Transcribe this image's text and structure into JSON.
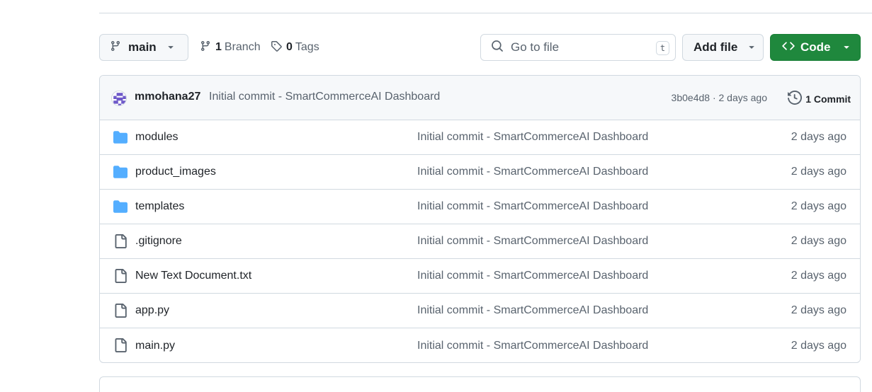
{
  "toolbar": {
    "branch": "main",
    "branches_count": "1",
    "branches_label": "Branch",
    "tags_count": "0",
    "tags_label": "Tags",
    "search_placeholder": "Go to file",
    "search_shortcut": "t",
    "add_file_label": "Add file",
    "code_label": "Code",
    "code_color": "#1f883d"
  },
  "commit": {
    "author": "mmohana27",
    "message": "Initial commit - SmartCommerceAI Dashboard",
    "hash_age": "3b0e4d8 · 2 days ago",
    "count_label": "1 Commit"
  },
  "files": [
    {
      "name": "modules",
      "type": "folder-icon",
      "message": "Initial commit - SmartCommerceAI Dashboard",
      "age": "2 days ago"
    },
    {
      "name": "product_images",
      "type": "folder-icon",
      "message": "Initial commit - SmartCommerceAI Dashboard",
      "age": "2 days ago"
    },
    {
      "name": "templates",
      "type": "folder-icon",
      "message": "Initial commit - SmartCommerceAI Dashboard",
      "age": "2 days ago"
    },
    {
      "name": ".gitignore",
      "type": "file-icon",
      "message": "Initial commit - SmartCommerceAI Dashboard",
      "age": "2 days ago"
    },
    {
      "name": "New Text Document.txt",
      "type": "file-icon",
      "message": "Initial commit - SmartCommerceAI Dashboard",
      "age": "2 days ago"
    },
    {
      "name": "app.py",
      "type": "file-icon",
      "message": "Initial commit - SmartCommerceAI Dashboard",
      "age": "2 days ago"
    },
    {
      "name": "main.py",
      "type": "file-icon",
      "message": "Initial commit - SmartCommerceAI Dashboard",
      "age": "2 days ago"
    }
  ]
}
